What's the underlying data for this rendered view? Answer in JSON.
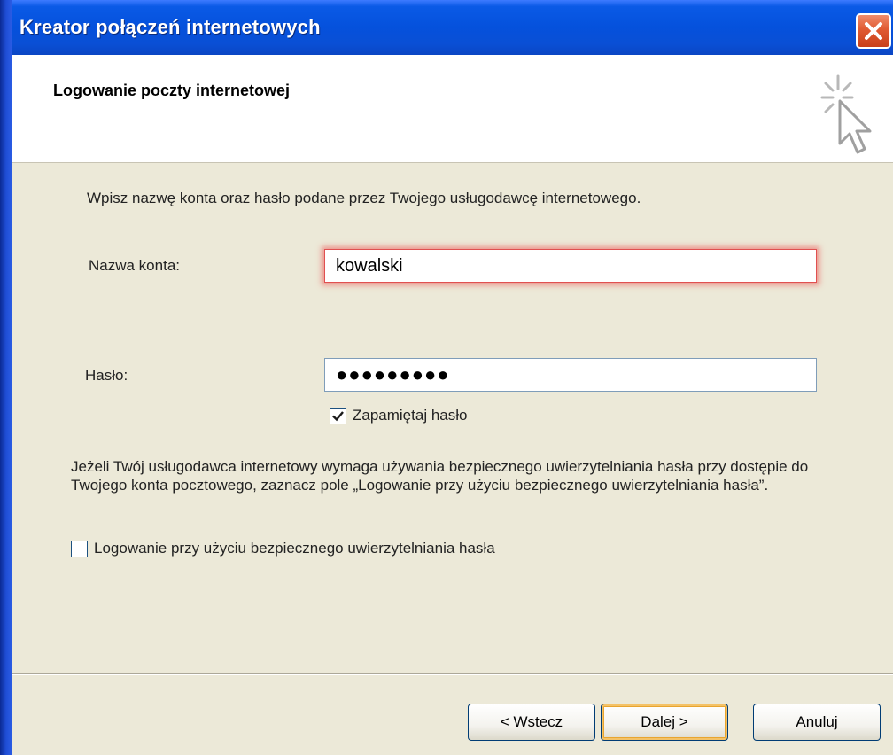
{
  "window": {
    "title": "Kreator połączeń internetowych"
  },
  "header": {
    "title": "Logowanie poczty internetowej",
    "icon": "wizard-cursor-icon"
  },
  "form": {
    "instruction": "Wpisz nazwę konta oraz hasło podane przez Twojego usługodawcę internetowego.",
    "account_label": "Nazwa konta:",
    "account_value": "kowalski",
    "password_label": "Hasło:",
    "password_value": "●●●●●●●●●",
    "remember_label": "Zapamiętaj hasło",
    "remember_checked": true,
    "spa_paragraph": "Jeżeli Twój usługodawca internetowy wymaga używania bezpiecznego uwierzytelniania hasła przy dostępie do Twojego konta pocztowego, zaznacz pole „Logowanie przy użyciu bezpiecznego uwierzytelniania hasła”.",
    "spa_label": "Logowanie przy użyciu bezpiecznego uwierzytelniania hasła",
    "spa_checked": false
  },
  "buttons": {
    "back": "< Wstecz",
    "next": "Dalej >",
    "cancel": "Anuluj"
  },
  "colors": {
    "titlebar": "#0551dc",
    "close": "#e05a32",
    "background": "#ece9d8",
    "focus_glow": "#ec5050"
  }
}
